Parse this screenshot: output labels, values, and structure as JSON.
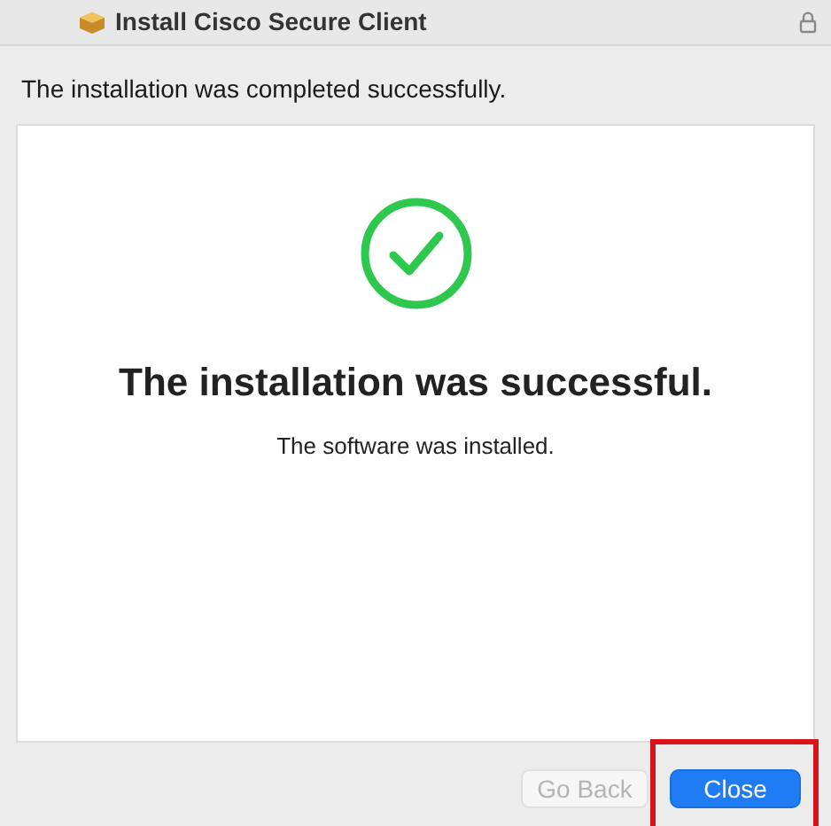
{
  "window": {
    "title": "Install Cisco Secure Client",
    "locked": true
  },
  "status_message": "The installation was completed successfully.",
  "panel": {
    "heading": "The installation was successful.",
    "detail": "The software was installed."
  },
  "buttons": [
    {
      "label": "Go Back",
      "kind": "secondary",
      "disabled": true,
      "highlighted": false
    },
    {
      "label": "Close",
      "kind": "primary",
      "disabled": false,
      "highlighted": true
    }
  ]
}
